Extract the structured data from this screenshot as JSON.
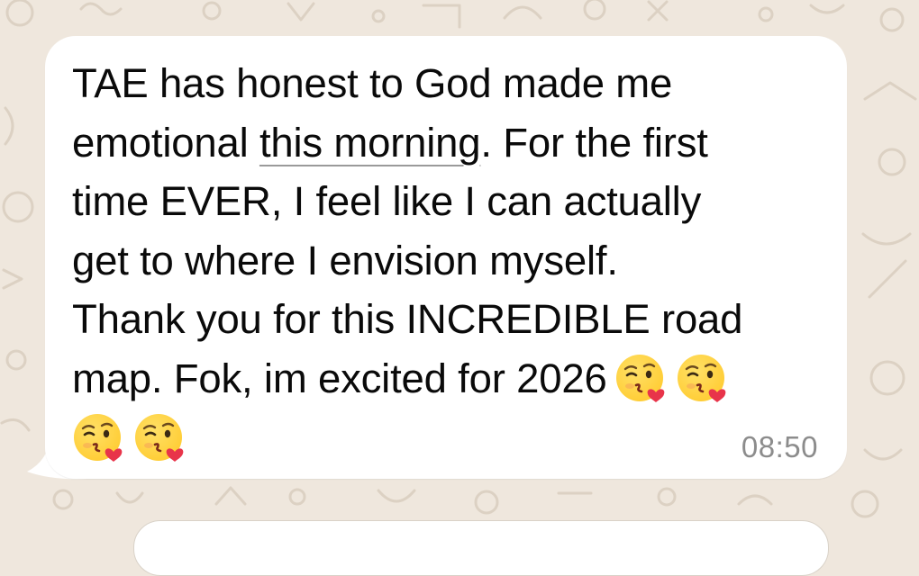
{
  "message": {
    "lines": [
      "TAE has honest to God made me",
      "emotional ",
      "this morning",
      ". For the first",
      "time EVER, I feel like I can actually",
      "get to where I envision myself.",
      "Thank you for this INCREDIBLE road",
      "map. Fok, im excited for 2026"
    ],
    "emoji_name": "face-blowing-a-kiss-emoji",
    "emoji_count": 4,
    "timestamp": "08:50"
  },
  "colors": {
    "wallpaper": "#efe7dd",
    "bubble": "#ffffff",
    "text": "#0a0a0a",
    "timestamp": "#8c8c8c",
    "emoji_face": "#ffcc33",
    "emoji_heart": "#e8344a"
  }
}
